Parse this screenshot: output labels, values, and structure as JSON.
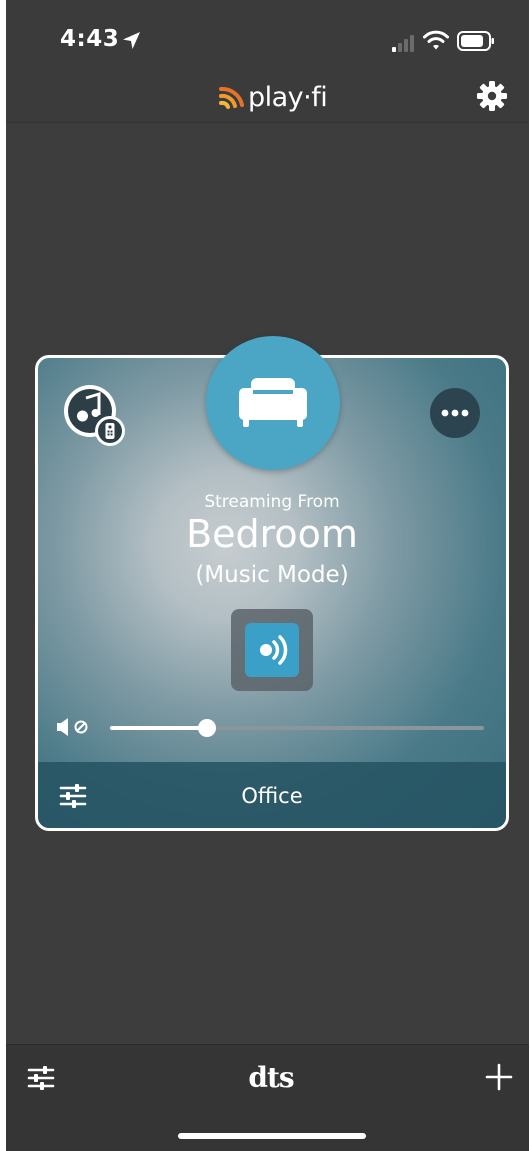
{
  "status_bar": {
    "time": "4:43"
  },
  "header": {
    "logo_text": "play·fi",
    "accent_color": "#f39a2b"
  },
  "zone_card": {
    "streaming_label": "Streaming From",
    "zone_name": "Bedroom",
    "zone_mode": "(Music Mode)",
    "footer_label": "Office",
    "volume_level": 0.26,
    "badge_color": "#4aa6c4",
    "stream_button_color": "#3aa0c8"
  },
  "bottom_bar": {
    "brand_text": "dts"
  },
  "icons": {
    "status": [
      "location-arrow-icon",
      "signal-icon",
      "wifi-icon",
      "battery-icon"
    ],
    "header": [
      "play-fi-logo-icon",
      "gear-icon"
    ],
    "card": [
      "music-source-icon",
      "remote-badge-icon",
      "speaker-icon",
      "more-icon",
      "stream-icon",
      "mute-icon",
      "equalizer-icon"
    ],
    "bottom": [
      "equalizer-icon",
      "add-icon"
    ]
  }
}
